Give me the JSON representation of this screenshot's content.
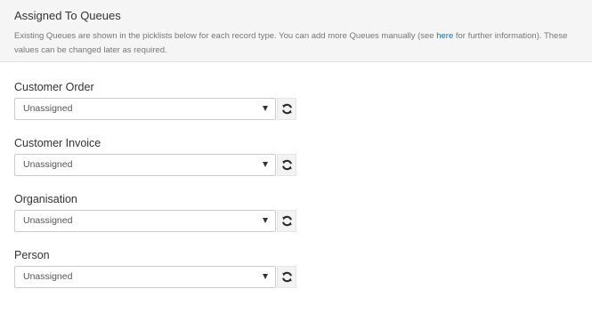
{
  "header": {
    "title": "Assigned To Queues",
    "desc_part1": "Existing Queues are shown in the picklists below for each record type. You can add more Queues manually (see ",
    "desc_link": "here",
    "desc_part2": " for further information). These values can be changed later as required."
  },
  "fields": [
    {
      "label": "Customer Order",
      "value": "Unassigned",
      "icon": "refresh-icon"
    },
    {
      "label": "Customer Invoice",
      "value": "Unassigned",
      "icon": "refresh-icon"
    },
    {
      "label": "Organisation",
      "value": "Unassigned",
      "icon": "refresh-icon"
    },
    {
      "label": "Person",
      "value": "Unassigned",
      "icon": "refresh-icon"
    }
  ],
  "colors": {
    "header_bg": "#f5f5f5",
    "link": "#1a6fb5",
    "text": "#333333",
    "muted": "#777777"
  }
}
